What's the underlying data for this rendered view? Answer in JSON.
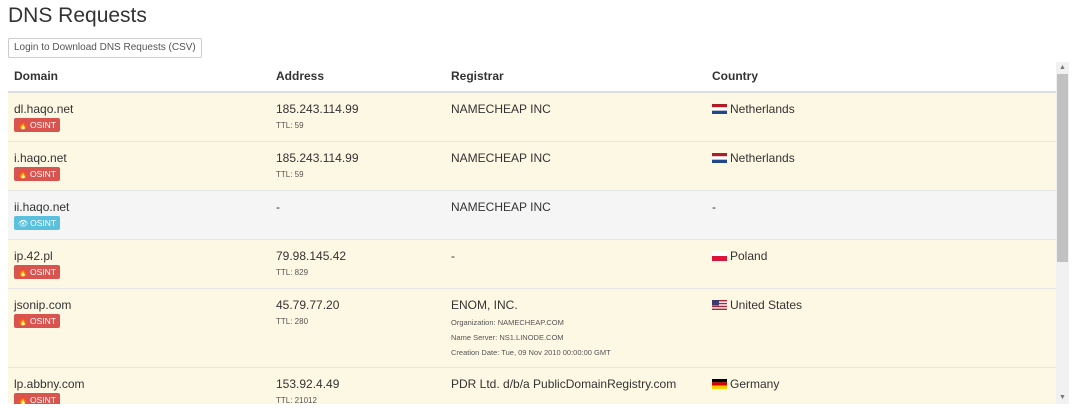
{
  "page": {
    "title": "DNS Requests",
    "download_button": "Login to Download DNS Requests (CSV)"
  },
  "table": {
    "headers": {
      "domain": "Domain",
      "address": "Address",
      "registrar": "Registrar",
      "country": "Country"
    },
    "rows": [
      {
        "domain": "dl.haqo.net",
        "badge": "OSINT",
        "badge_type": "malicious",
        "address": "185.243.114.99",
        "ttl": "TTL: 59",
        "registrar": "NAMECHEAP INC",
        "country": "Netherlands",
        "flag": "nl"
      },
      {
        "domain": "i.haqo.net",
        "badge": "OSINT",
        "badge_type": "malicious",
        "address": "185.243.114.99",
        "ttl": "TTL: 59",
        "registrar": "NAMECHEAP INC",
        "country": "Netherlands",
        "flag": "nl"
      },
      {
        "domain": "ii.haqo.net",
        "badge": "OSINT",
        "badge_type": "info",
        "address": "-",
        "ttl": "",
        "registrar": "NAMECHEAP INC",
        "country": "-",
        "flag": ""
      },
      {
        "domain": "ip.42.pl",
        "badge": "OSINT",
        "badge_type": "malicious",
        "address": "79.98.145.42",
        "ttl": "TTL: 829",
        "registrar": "-",
        "country": "Poland",
        "flag": "pl"
      },
      {
        "domain": "jsonip.com",
        "badge": "OSINT",
        "badge_type": "malicious",
        "address": "45.79.77.20",
        "ttl": "TTL: 280",
        "registrar": "ENOM, INC.",
        "registrar_details": [
          "Organization: NAMECHEAP.COM",
          "Name Server: NS1.LINODE.COM",
          "Creation Date: Tue, 09 Nov 2010 00:00:00 GMT"
        ],
        "country": "United States",
        "flag": "us"
      },
      {
        "domain": "lp.abbny.com",
        "badge": "OSINT",
        "badge_type": "malicious",
        "address": "153.92.4.49",
        "ttl": "TTL: 21012",
        "registrar": "PDR Ltd. d/b/a PublicDomainRegistry.com",
        "country": "Germany",
        "flag": "de"
      }
    ]
  },
  "colors": {
    "malicious_row": "#fcf8e3",
    "info_row": "#f5f5f5",
    "badge_red": "#d9534f",
    "badge_blue": "#5bc0de"
  },
  "icons": {
    "malicious_badge": "fire-icon",
    "info_badge": "eye-icon",
    "scroll_up": "triangle-up-icon",
    "scroll_down": "triangle-down-icon"
  }
}
